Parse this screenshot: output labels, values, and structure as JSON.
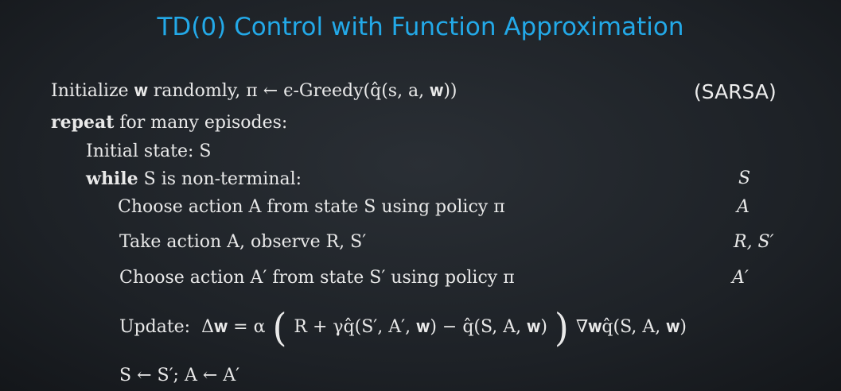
{
  "title": "TD(0) Control with Function Approximation",
  "algorithm_name": "(SARSA)",
  "pseudocode": {
    "init": "Initialize 𝐰 randomly, π ← ϵ-Greedy(q̂(s, a, 𝐰))",
    "repeat_keyword": "repeat",
    "repeat_rest": " for many episodes:",
    "initial_state": "Initial state: S",
    "while_keyword": "while",
    "while_rest": " S is non-terminal:",
    "choose_action": "Choose action A from state S using policy π",
    "take_action": "Take action A, observe R, S′",
    "choose_next": "Choose action A′ from state S′ using policy π",
    "update_label": "Update:",
    "update_lhs": "Δ𝐰 = α",
    "update_inner": "R + γq̂(S′, A′, 𝐰) − q̂(S, A, 𝐰)",
    "update_rhs": "∇𝐰q̂(S, A, 𝐰)",
    "assign": "S ← S′; A ← A′"
  },
  "sarsa_column": {
    "s": "S",
    "a": "A",
    "r_s_prime": "R, S′",
    "a_prime": "A′"
  }
}
